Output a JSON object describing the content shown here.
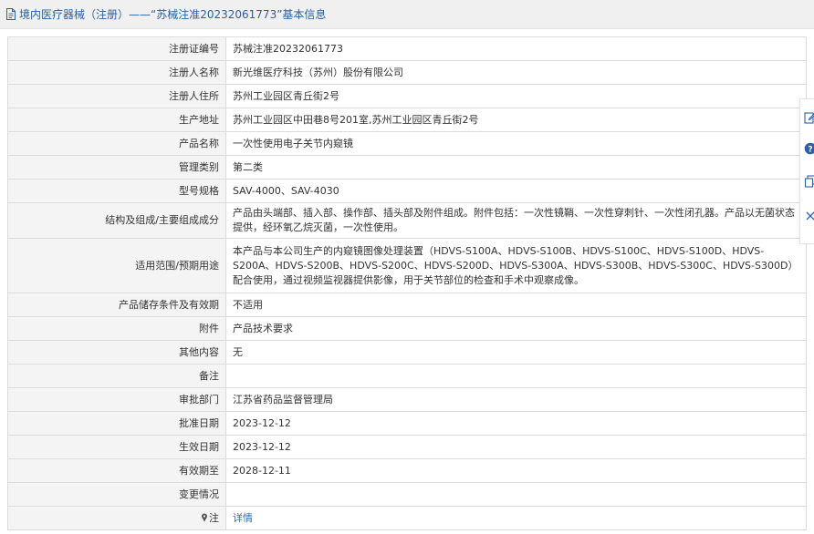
{
  "header": {
    "title": "境内医疗器械（注册）——“苏械注准20232061773”基本信息",
    "icon": "document-icon"
  },
  "rows": [
    {
      "label": "注册证编号",
      "value": "苏械注准20232061773"
    },
    {
      "label": "注册人名称",
      "value": "新光维医疗科技（苏州）股份有限公司"
    },
    {
      "label": "注册人住所",
      "value": "苏州工业园区青丘街2号"
    },
    {
      "label": "生产地址",
      "value": "苏州工业园区中田巷8号201室,苏州工业园区青丘街2号"
    },
    {
      "label": "产品名称",
      "value": "一次性使用电子关节内窥镜"
    },
    {
      "label": "管理类别",
      "value": "第二类"
    },
    {
      "label": "型号规格",
      "value": "SAV-4000、SAV-4030"
    },
    {
      "label": "结构及组成/主要组成成分",
      "value": "产品由头端部、插入部、操作部、插头部及附件组成。附件包括：一次性镜鞘、一次性穿刺针、一次性闭孔器。产品以无菌状态提供，经环氧乙烷灭菌，一次性使用。"
    },
    {
      "label": "适用范围/预期用途",
      "value": "本产品与本公司生产的内窥镜图像处理装置（HDVS-S100A、HDVS-S100B、HDVS-S100C、HDVS-S100D、HDVS-S200A、HDVS-S200B、HDVS-S200C、HDVS-S200D、HDVS-S300A、HDVS-S300B、HDVS-S300C、HDVS-S300D）配合使用，通过视频监视器提供影像，用于关节部位的检查和手术中观察成像。"
    },
    {
      "label": "产品储存条件及有效期",
      "value": "不适用"
    },
    {
      "label": "附件",
      "value": "产品技术要求"
    },
    {
      "label": "其他内容",
      "value": "无"
    },
    {
      "label": "备注",
      "value": ""
    },
    {
      "label": "审批部门",
      "value": "江苏省药品监督管理局"
    },
    {
      "label": "批准日期",
      "value": "2023-12-12"
    },
    {
      "label": "生效日期",
      "value": "2023-12-12"
    },
    {
      "label": "有效期至",
      "value": "2028-12-11"
    },
    {
      "label": "变更情况",
      "value": ""
    }
  ],
  "note_row": {
    "label": "注",
    "link_text": "详情",
    "icon": "pin-icon"
  },
  "side_tools": [
    {
      "icon": "edit-icon"
    },
    {
      "icon": "help-icon"
    },
    {
      "icon": "copy-icon"
    },
    {
      "icon": "close-icon"
    }
  ],
  "colors": {
    "link": "#2b6cb8",
    "title": "#2b5fa6",
    "label_bg": "#f4f4f4",
    "border": "#dcdcdc"
  }
}
